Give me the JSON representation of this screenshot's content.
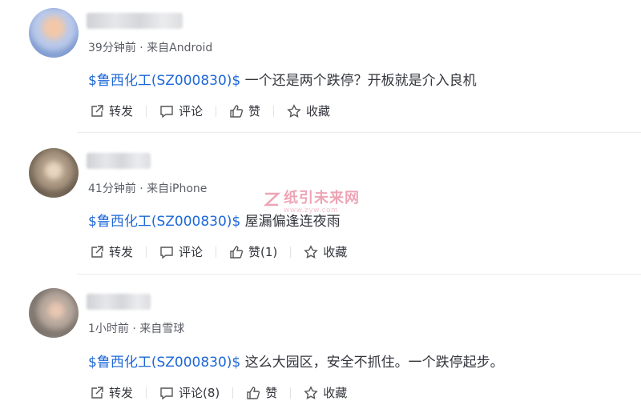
{
  "posts": [
    {
      "meta": "39分钟前 · 来自Android",
      "stock": "$鲁西化工(SZ000830)$",
      "text": " 一个还是两个跌停？开板就是介入良机",
      "actions": {
        "repost": "转发",
        "comment": "评论",
        "like": "赞",
        "favorite": "收藏"
      }
    },
    {
      "meta": "41分钟前 · 来自iPhone",
      "stock": "$鲁西化工(SZ000830)$",
      "text": " 屋漏偏逢连夜雨",
      "actions": {
        "repost": "转发",
        "comment": "评论",
        "like": "赞(1)",
        "favorite": "收藏"
      }
    },
    {
      "meta": "1小时前 · 来自雪球",
      "stock": "$鲁西化工(SZ000830)$",
      "text": " 这么大园区，安全不抓住。一个跌停起步。",
      "actions": {
        "repost": "转发",
        "comment": "评论(8)",
        "like": "赞",
        "favorite": "收藏"
      }
    }
  ],
  "watermark": {
    "title": "纸引未来网",
    "sub": "www.zyw.com"
  },
  "colors": {
    "stock_link": "#1e68d8",
    "text": "#33353c",
    "meta": "#5a5d66"
  }
}
